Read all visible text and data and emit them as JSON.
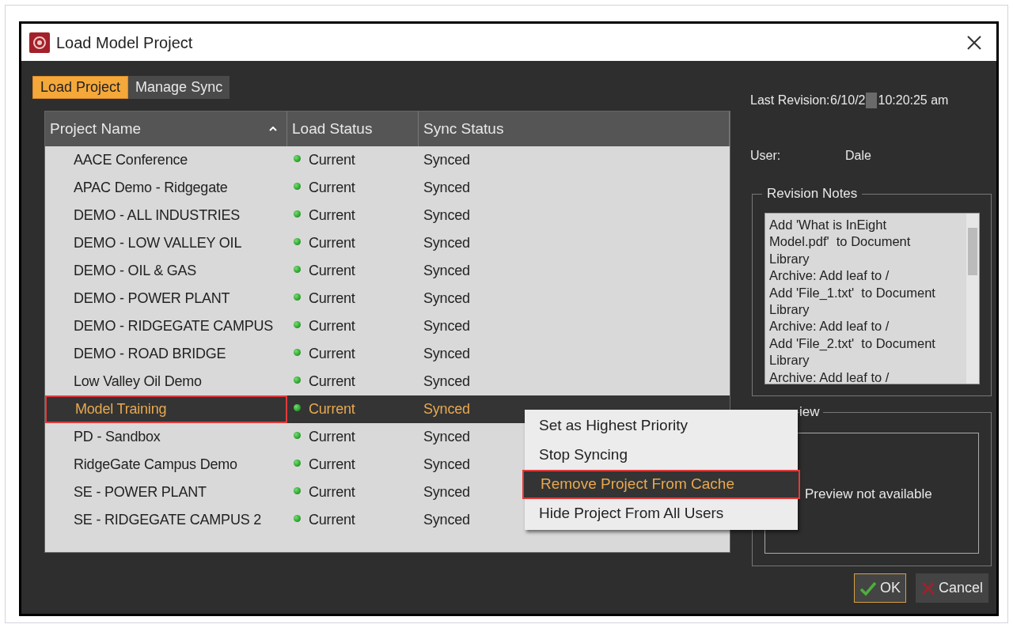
{
  "window": {
    "title": "Load Model Project"
  },
  "tabs": [
    {
      "label": "Load Project",
      "selected": true
    },
    {
      "label": "Manage Sync",
      "selected": false
    }
  ],
  "table": {
    "columns": [
      {
        "label": "Project Name",
        "sorted": true
      },
      {
        "label": "Load Status",
        "sorted": false
      },
      {
        "label": "Sync Status",
        "sorted": false
      }
    ],
    "rows": [
      {
        "name": "AACE Conference",
        "load_status": "Current",
        "sync_status": "Synced",
        "selected": false
      },
      {
        "name": "APAC Demo - Ridgegate",
        "load_status": "Current",
        "sync_status": "Synced",
        "selected": false
      },
      {
        "name": "DEMO - ALL INDUSTRIES",
        "load_status": "Current",
        "sync_status": "Synced",
        "selected": false
      },
      {
        "name": "DEMO - LOW VALLEY OIL",
        "load_status": "Current",
        "sync_status": "Synced",
        "selected": false
      },
      {
        "name": "DEMO - OIL & GAS",
        "load_status": "Current",
        "sync_status": "Synced",
        "selected": false
      },
      {
        "name": "DEMO - POWER PLANT",
        "load_status": "Current",
        "sync_status": "Synced",
        "selected": false
      },
      {
        "name": "DEMO - RIDGEGATE CAMPUS",
        "load_status": "Current",
        "sync_status": "Synced",
        "selected": false
      },
      {
        "name": "DEMO - ROAD BRIDGE",
        "load_status": "Current",
        "sync_status": "Synced",
        "selected": false
      },
      {
        "name": "Low Valley Oil Demo",
        "load_status": "Current",
        "sync_status": "Synced",
        "selected": false
      },
      {
        "name": "Model Training",
        "load_status": "Current",
        "sync_status": "Synced",
        "selected": true
      },
      {
        "name": "PD - Sandbox",
        "load_status": "Current",
        "sync_status": "Synced",
        "selected": false
      },
      {
        "name": "RidgeGate Campus Demo",
        "load_status": "Current",
        "sync_status": "Synced",
        "selected": false
      },
      {
        "name": "SE - POWER PLANT",
        "load_status": "Current",
        "sync_status": "Synced",
        "selected": false
      },
      {
        "name": "SE - RIDGEGATE CAMPUS 2",
        "load_status": "Current",
        "sync_status": "Synced",
        "selected": false
      }
    ]
  },
  "details": {
    "last_revision_label": "Last Revision:",
    "last_revision_date": "6/10/2",
    "last_revision_time": "10:20:25 am",
    "user_label": "User:",
    "user_value": "Dale"
  },
  "revision_notes": {
    "title": "Revision Notes",
    "lines": [
      "Add 'What is InEight",
      "Model.pdf'  to Document",
      "Library",
      "Archive: Add leaf to /",
      "Add 'File_1.txt'  to Document",
      "Library",
      "Archive: Add leaf to /",
      "Add 'File_2.txt'  to Document",
      "Library",
      "Archive: Add leaf to /"
    ]
  },
  "preview": {
    "title": "iew",
    "message": "Preview not available"
  },
  "context_menu": [
    {
      "label": "Set as Highest Priority",
      "selected": false
    },
    {
      "label": "Stop Syncing",
      "selected": false
    },
    {
      "label": "Remove Project From Cache",
      "selected": true
    },
    {
      "label": "Hide Project From All Users",
      "selected": false
    }
  ],
  "buttons": [
    {
      "kind": "ok",
      "label": "OK",
      "focused": true
    },
    {
      "kind": "cancel",
      "label": "Cancel",
      "focused": false
    }
  ]
}
